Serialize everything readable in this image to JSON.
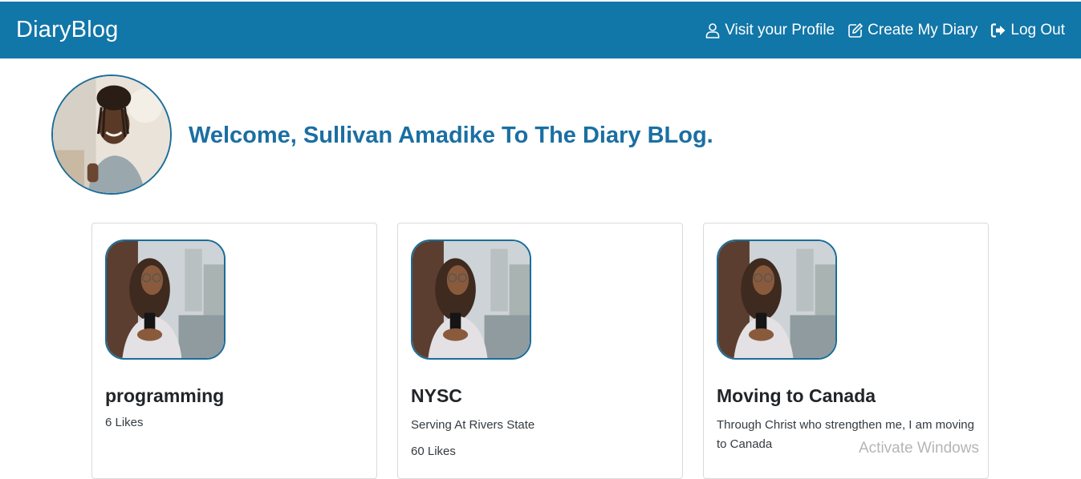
{
  "nav": {
    "brand": "DiaryBlog",
    "links": [
      {
        "label": "Visit your Profile",
        "icon": "user-icon"
      },
      {
        "label": "Create My Diary",
        "icon": "edit-icon"
      },
      {
        "label": "Log Out",
        "icon": "sign-out-icon"
      }
    ]
  },
  "welcome": {
    "text": "Welcome, Sullivan Amadike To The Diary BLog."
  },
  "diaries": [
    {
      "title": "programming",
      "description": "",
      "likes": "6 Likes"
    },
    {
      "title": "NYSC",
      "description": "Serving At Rivers State",
      "likes": "60 Likes"
    },
    {
      "title": "Moving to Canada",
      "description": "Through Christ who strengthen me, I am moving to Canada",
      "likes": ""
    }
  ],
  "watermark": "Activate Windows",
  "colors": {
    "navbar": "#1176a8",
    "accent": "#1a6fa3",
    "border": "#1b6d99"
  }
}
